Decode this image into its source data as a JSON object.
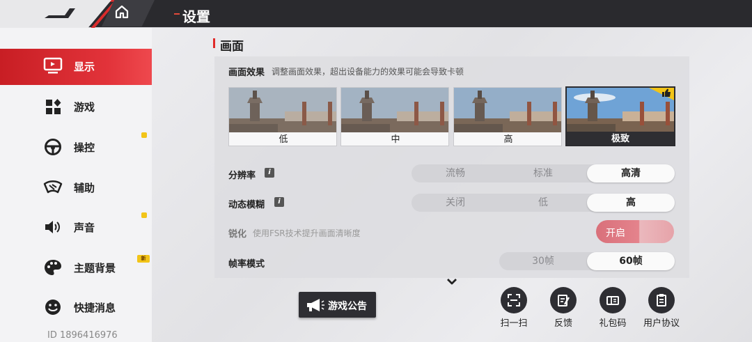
{
  "header": {
    "title": "设置"
  },
  "sidebar": {
    "items": [
      {
        "label": "显示",
        "icon": "monitor-icon"
      },
      {
        "label": "游戏",
        "icon": "apps-icon"
      },
      {
        "label": "操控",
        "icon": "steering-wheel-icon"
      },
      {
        "label": "辅助",
        "icon": "assist-icon"
      },
      {
        "label": "声音",
        "icon": "speaker-icon"
      },
      {
        "label": "主题背景",
        "icon": "palette-icon"
      },
      {
        "label": "快捷消息",
        "icon": "chat-smile-icon"
      }
    ],
    "new_badge": "新",
    "user_id": "ID 1896416976"
  },
  "main": {
    "section_title": "画面",
    "quality": {
      "label": "画面效果",
      "description": "调整画面效果，超出设备能力的效果可能会导致卡顿",
      "options": [
        "低",
        "中",
        "高",
        "极致"
      ],
      "selected": "极致"
    },
    "resolution": {
      "label": "分辨率",
      "options": [
        "流畅",
        "标准",
        "高清"
      ],
      "selected": "高清"
    },
    "motion_blur": {
      "label": "动态模糊",
      "options": [
        "关闭",
        "低",
        "高"
      ],
      "selected": "高"
    },
    "sharpen": {
      "label": "锐化",
      "description": "使用FSR技术提升画面清晰度",
      "toggle_label": "开启"
    },
    "frame_rate": {
      "label": "帧率模式",
      "options": [
        "30帧",
        "60帧"
      ],
      "selected": "60帧"
    }
  },
  "bottom": {
    "notice_label": "游戏公告",
    "tools": [
      {
        "label": "扫一扫",
        "icon": "scan-icon"
      },
      {
        "label": "反馈",
        "icon": "feedback-icon"
      },
      {
        "label": "礼包码",
        "icon": "gift-code-icon"
      },
      {
        "label": "用户协议",
        "icon": "user-agreement-icon"
      }
    ]
  },
  "colors": {
    "accent": "#e2333a",
    "dark": "#2e2e33",
    "badge": "#f2c418"
  }
}
